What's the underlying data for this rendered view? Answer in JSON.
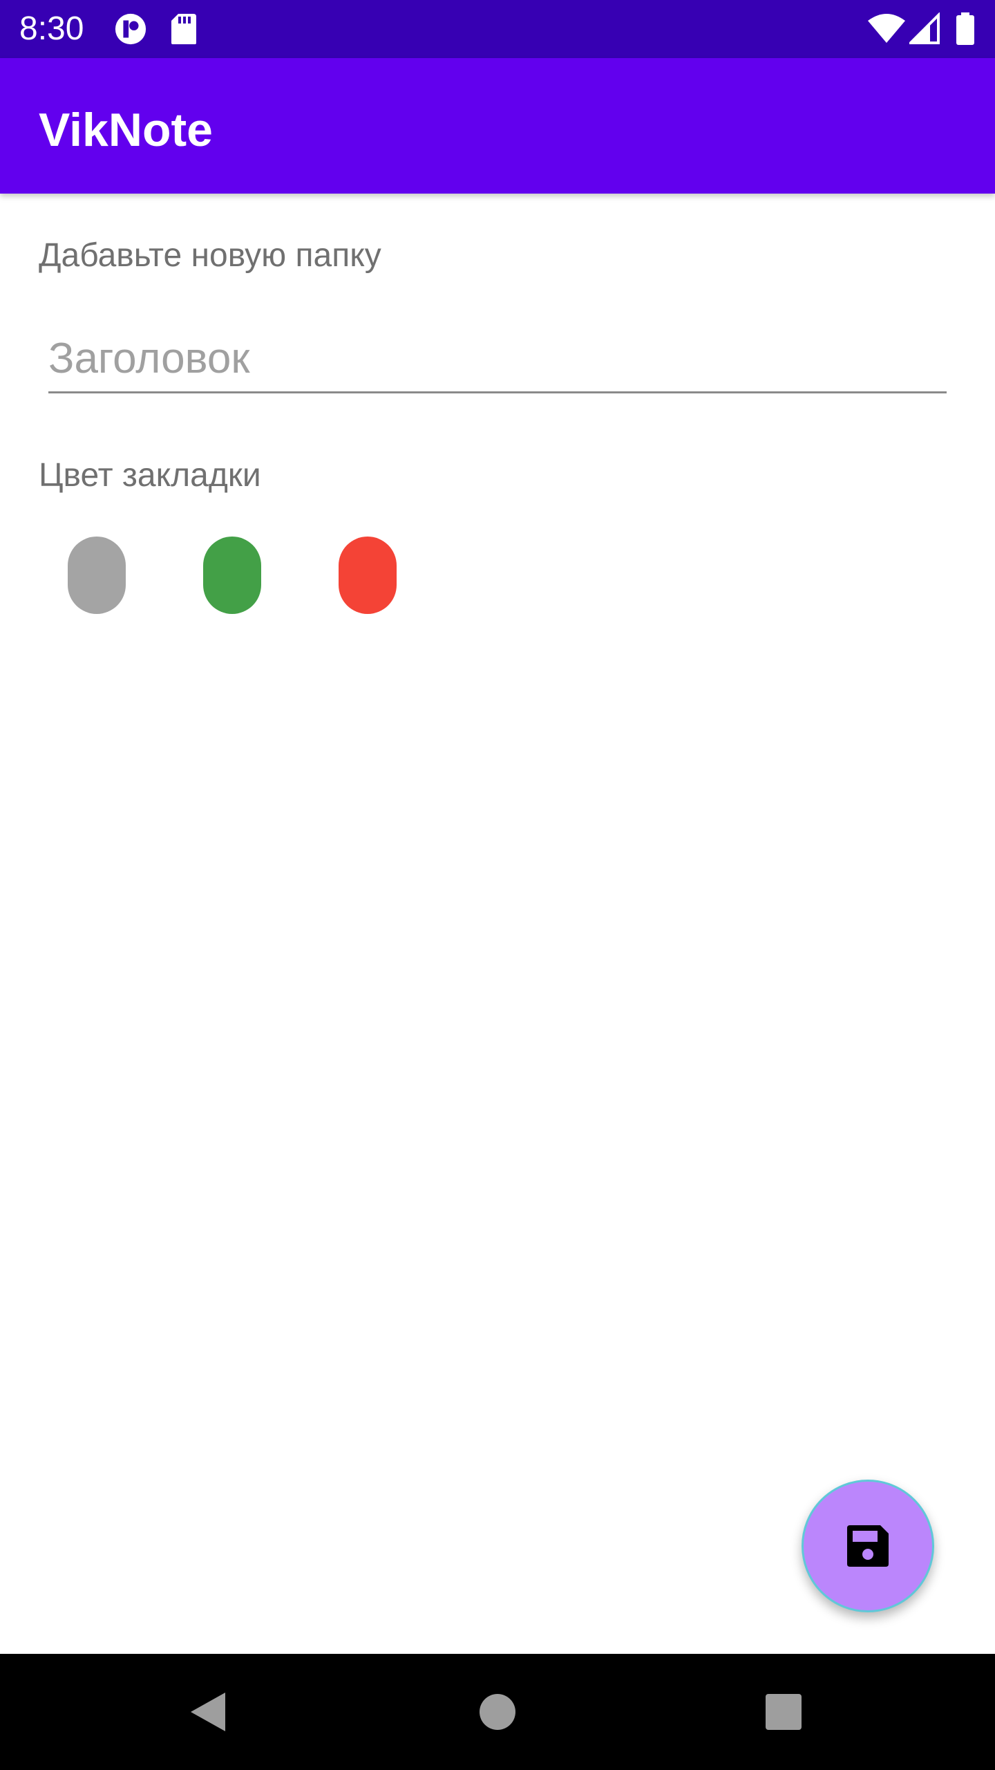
{
  "status_bar": {
    "time": "8:30",
    "icons": [
      "app-notification-icon",
      "sd-card-icon",
      "wifi-icon",
      "cell-signal-icon",
      "battery-icon"
    ],
    "background": "#3700b3"
  },
  "app_bar": {
    "title": "VikNote",
    "background": "#6200ee"
  },
  "form": {
    "heading": "Дабавьте новую папку",
    "title_input": {
      "value": "",
      "placeholder": "Заголовок"
    },
    "color_label": "Цвет закладки",
    "color_options": [
      {
        "name": "gray",
        "color": "#a4a4a4"
      },
      {
        "name": "green",
        "color": "#43a047"
      },
      {
        "name": "red",
        "color": "#f44336"
      }
    ]
  },
  "fab": {
    "icon": "save-icon",
    "color": "#bb86fc"
  },
  "nav_bar": {
    "buttons": [
      "back-icon",
      "home-icon",
      "recents-icon"
    ]
  }
}
